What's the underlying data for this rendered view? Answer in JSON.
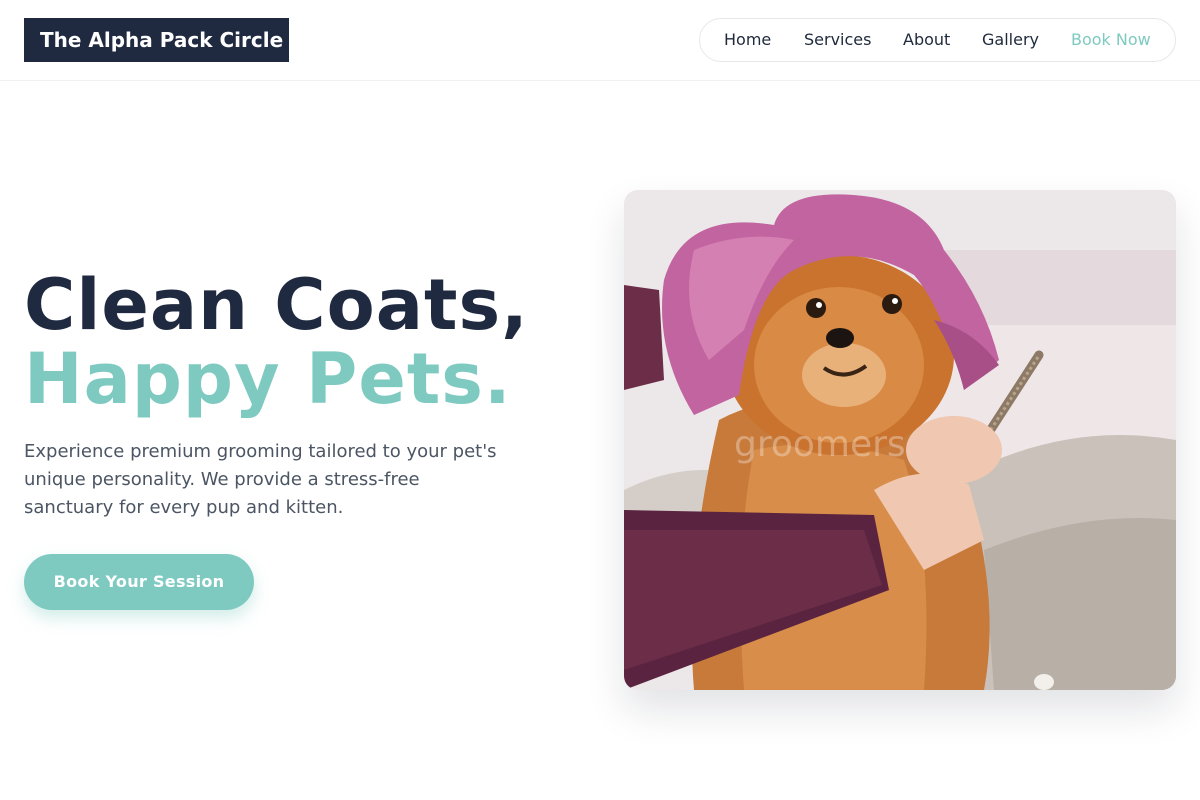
{
  "brand": {
    "name": "The Alpha Pack Circle"
  },
  "nav": {
    "items": [
      {
        "label": "Home"
      },
      {
        "label": "Services"
      },
      {
        "label": "About"
      },
      {
        "label": "Gallery"
      },
      {
        "label": "Book Now"
      }
    ]
  },
  "hero": {
    "headline_line1": "Clean Coats,",
    "headline_line2": "Happy Pets.",
    "description": "Experience premium grooming tailored to your pet's unique personality. We provide a stress-free sanctuary for every pup and kitten.",
    "cta_label": "Book Your Session",
    "image": {
      "subject": "pomeranian-dog-with-pink-towel-photo",
      "watermark": "groomers"
    }
  },
  "colors": {
    "navy": "#1f2a40",
    "teal": "#7ecac1",
    "text_muted": "#4b5563"
  }
}
